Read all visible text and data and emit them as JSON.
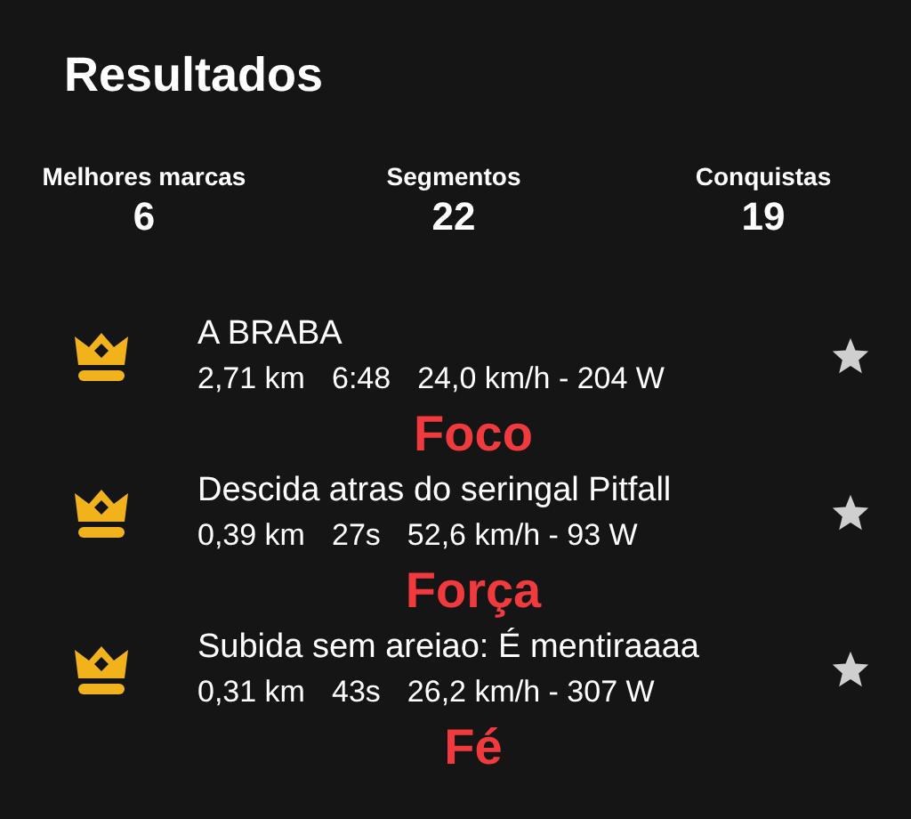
{
  "title": "Resultados",
  "stats": [
    {
      "label": "Melhores marcas",
      "value": "6"
    },
    {
      "label": "Segmentos",
      "value": "22"
    },
    {
      "label": "Conquistas",
      "value": "19"
    }
  ],
  "segments": [
    {
      "name": "A BRABA",
      "distance": "2,71 km",
      "time": "6:48",
      "detail": "24,0 km/h - 204 W",
      "caption": "Foco"
    },
    {
      "name": "Descida atras do seringal Pitfall",
      "distance": "0,39 km",
      "time": "27s",
      "detail": "52,6 km/h - 93 W",
      "caption": "Força"
    },
    {
      "name": "Subida sem areiao: É mentiraaaa",
      "distance": "0,31 km",
      "time": "43s",
      "detail": "26,2 km/h - 307 W",
      "caption": "Fé"
    }
  ]
}
